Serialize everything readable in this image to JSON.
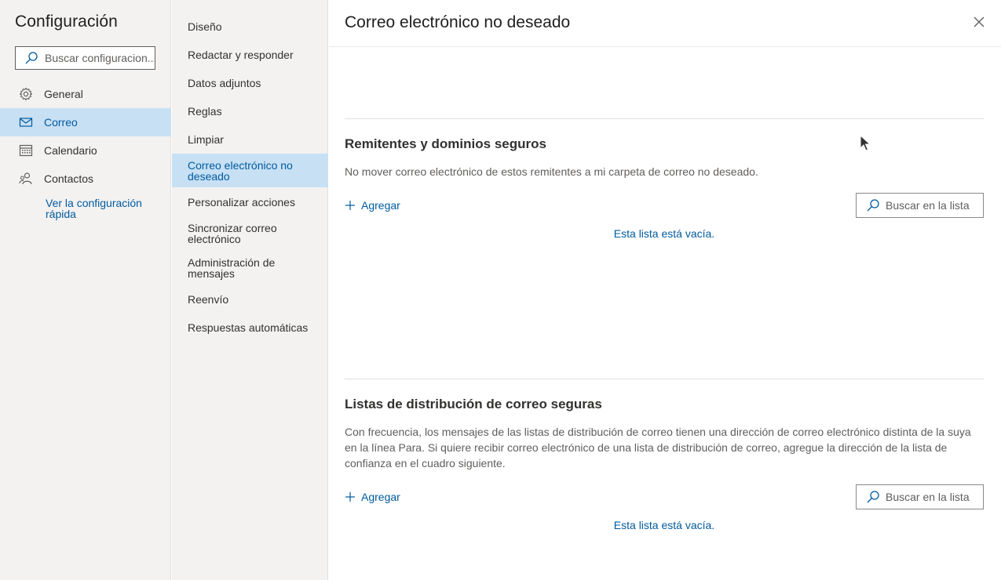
{
  "settings": {
    "title": "Configuración",
    "search": {
      "placeholder": "Buscar configuracion..."
    },
    "categories": [
      {
        "label": "General",
        "icon": "gear-icon"
      },
      {
        "label": "Correo",
        "icon": "mail-icon",
        "selected": true
      },
      {
        "label": "Calendario",
        "icon": "calendar-icon"
      },
      {
        "label": "Contactos",
        "icon": "people-icon"
      }
    ],
    "quick_settings_link": "Ver la configuración rápida"
  },
  "mail_nav": {
    "items": [
      {
        "label": "Diseño"
      },
      {
        "label": "Redactar y responder"
      },
      {
        "label": "Datos adjuntos"
      },
      {
        "label": "Reglas"
      },
      {
        "label": "Limpiar"
      },
      {
        "label": "Correo electrónico no deseado",
        "selected": true
      },
      {
        "label": "Personalizar acciones"
      },
      {
        "label": "Sincronizar correo electrónico"
      },
      {
        "label": "Administración de mensajes"
      },
      {
        "label": "Reenvío"
      },
      {
        "label": "Respuestas automáticas"
      }
    ]
  },
  "main": {
    "title": "Correo electrónico no deseado",
    "safe_senders": {
      "title": "Remitentes y dominios seguros",
      "description": "No mover correo electrónico de estos remitentes a mi carpeta de correo no deseado.",
      "add_label": "Agregar",
      "search_placeholder": "Buscar en la lista",
      "empty_text": "Esta lista está vacía."
    },
    "safe_lists": {
      "title": "Listas de distribución de correo seguras",
      "description": "Con frecuencia, los mensajes de las listas de distribución de correo tienen una dirección de correo electrónico distinta de la suya en la línea Para. Si quiere recibir correo electrónico de una lista de distribución de correo, agregue la dirección de la lista de confianza en el cuadro siguiente.",
      "add_label": "Agregar",
      "search_placeholder": "Buscar en la lista",
      "empty_text": "Esta lista está vacía."
    }
  },
  "colors": {
    "accent": "#005a9e",
    "selected_bg": "#c7e0f4",
    "nav_bg": "#f3f2f1"
  }
}
